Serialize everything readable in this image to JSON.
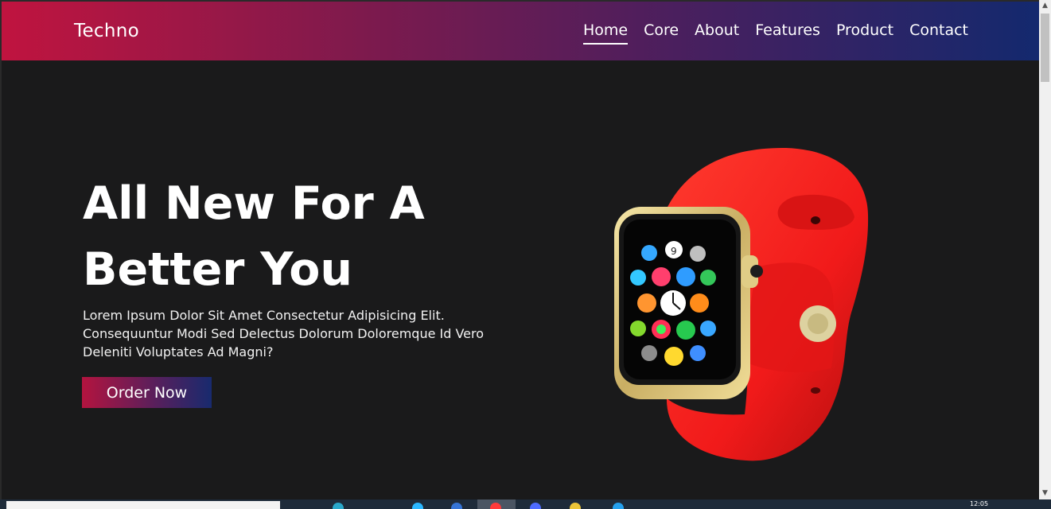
{
  "navbar": {
    "brand": "Techno",
    "items": [
      {
        "label": "Home",
        "active": true
      },
      {
        "label": "Core",
        "active": false
      },
      {
        "label": "About",
        "active": false
      },
      {
        "label": "Features",
        "active": false
      },
      {
        "label": "Product",
        "active": false
      },
      {
        "label": "Contact",
        "active": false
      }
    ]
  },
  "hero": {
    "title_line1": "All New For A",
    "title_line2": "Better You",
    "text_line1": "Lorem Ipsum Dolor Sit Amet Consectetur Adipisicing Elit.",
    "text_line2": "Consequuntur Modi Sed Delectus Dolorum Doloremque Id Vero",
    "text_line3": "Deleniti Voluptates Ad Magni?",
    "button_label": "Order Now",
    "product_image": "red-smartwatch-image"
  },
  "taskbar": {
    "clock": "12:05"
  },
  "colors": {
    "gradient_start": "#c0143f",
    "gradient_end": "#13296e",
    "background": "#1a1a1b",
    "watch_band": "#ff1c1c",
    "watch_case": "#d9c27a"
  },
  "icons": [
    "scroll-up-arrow-icon",
    "scroll-down-arrow-icon"
  ]
}
